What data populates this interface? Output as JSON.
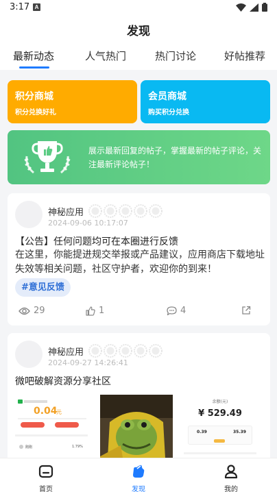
{
  "status": {
    "time": "3:17",
    "notif_letter": "A"
  },
  "header": {
    "title": "发现"
  },
  "tabs": [
    {
      "label": "最新动态",
      "active": true
    },
    {
      "label": "人气热门",
      "active": false
    },
    {
      "label": "热门讨论",
      "active": false
    },
    {
      "label": "好帖推荐",
      "active": false
    }
  ],
  "promos": [
    {
      "title": "积分商城",
      "subtitle": "积分兑换好礼",
      "color": "#ffab00"
    },
    {
      "title": "会员商城",
      "subtitle": "购买积分兑换",
      "color": "#09b9f2"
    }
  ],
  "banner": {
    "text": "展示最新回复的帖子，掌握最新的帖子评论，关注最新评论帖子！",
    "icon": "trophy-icon"
  },
  "posts": [
    {
      "author": "神秘应用",
      "date": "2024-09-06 10:17:07",
      "title": "【公告】任何问题均可在本圈进行反馈",
      "body": "在这里，你能提进规交举报或产品建议，应用商店下载地址失效等相关问题，社区守护者，欢迎你的到来！",
      "tag": "#意见反馈",
      "views": "29",
      "likes": "1",
      "comments": "4"
    },
    {
      "author": "神秘应用",
      "date": "2024-09-27 14:26:41",
      "title": "微吧破解资源分享社区",
      "thumb1": {
        "amount": "0.04",
        "unit": "元",
        "btn1": "",
        "btn2": "",
        "name": "刚刚",
        "pct": "1.79%"
      },
      "thumb3": {
        "header": "余额(元)",
        "amount": "¥ 529.49",
        "stat1": "0.39",
        "stat2": "35.39"
      }
    }
  ],
  "bottom_nav": [
    {
      "label": "首页",
      "icon": "home-icon",
      "active": false
    },
    {
      "label": "发现",
      "icon": "discover-icon",
      "active": true
    },
    {
      "label": "我的",
      "icon": "profile-icon",
      "active": false
    }
  ],
  "colors": {
    "accent": "#1e7bff",
    "tag_bg": "#e4ecfa",
    "banner_green": "#5ccc84"
  }
}
